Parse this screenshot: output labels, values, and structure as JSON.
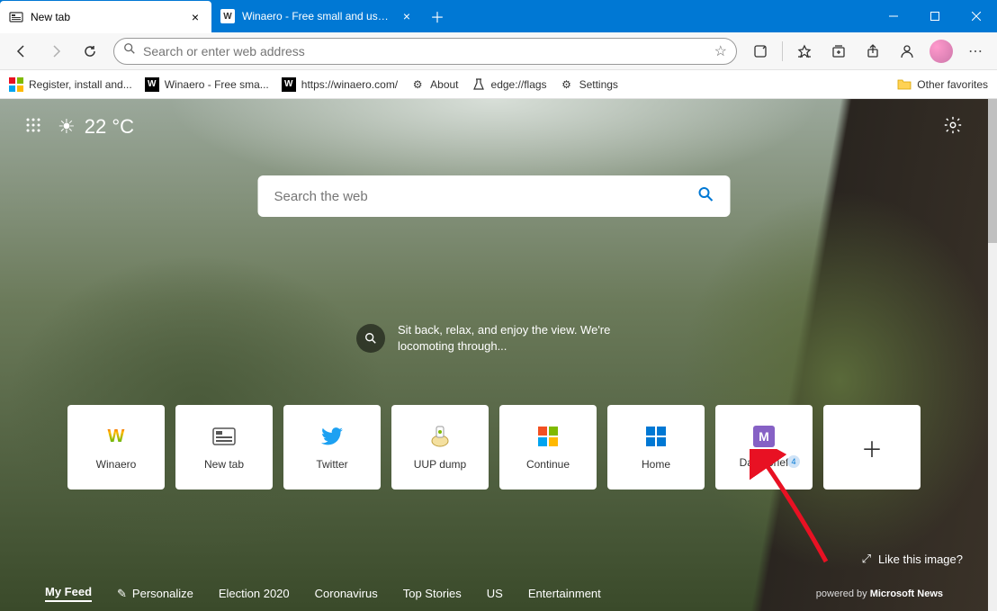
{
  "titlebar": {
    "tabs": [
      {
        "label": "New tab",
        "active": true
      },
      {
        "label": "Winaero - Free small and useful",
        "active": false
      }
    ]
  },
  "addressbar": {
    "placeholder": "Search or enter web address"
  },
  "bookmarks": {
    "items": [
      {
        "label": "Register, install and..."
      },
      {
        "label": "Winaero - Free sma..."
      },
      {
        "label": "https://winaero.com/"
      },
      {
        "label": "About"
      },
      {
        "label": "edge://flags"
      },
      {
        "label": "Settings"
      }
    ],
    "other": "Other favorites"
  },
  "ntp": {
    "temperature": "22 °C",
    "search_placeholder": "Search the web",
    "caption": "Sit back, relax, and enjoy the view. We're locomoting through...",
    "tiles": [
      {
        "label": "Winaero"
      },
      {
        "label": "New tab"
      },
      {
        "label": "Twitter"
      },
      {
        "label": "UUP dump"
      },
      {
        "label": "Continue"
      },
      {
        "label": "Home"
      },
      {
        "label": "Daily Brief",
        "badge": "4"
      }
    ],
    "like_label": "Like this image?",
    "feed": [
      "My Feed",
      "Personalize",
      "Election 2020",
      "Coronavirus",
      "Top Stories",
      "US",
      "Entertainment"
    ],
    "powered_prefix": "powered by ",
    "powered_name": "Microsoft News"
  }
}
